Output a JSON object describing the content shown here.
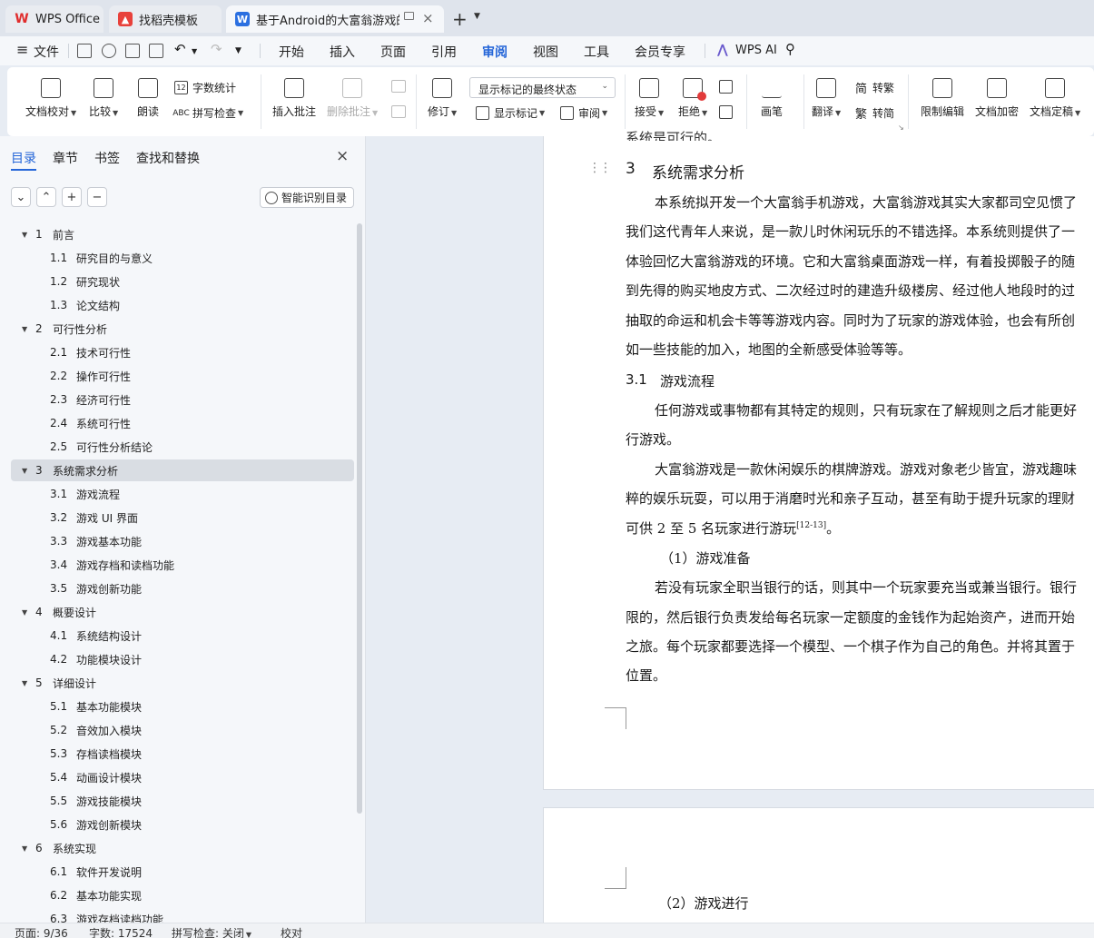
{
  "tabs": [
    {
      "label": "WPS Office",
      "icon": "wps-logo-icon",
      "color": "#e02d2d"
    },
    {
      "label": "找稻壳模板",
      "icon": "docer-logo-icon",
      "color": "#e8413b"
    },
    {
      "label": "基于Android的大富翁游戏的设",
      "icon": "word-doc-icon",
      "color": "#2b6fe0"
    }
  ],
  "menu": {
    "file": "文件",
    "items": [
      "开始",
      "插入",
      "页面",
      "引用",
      "审阅",
      "视图",
      "工具",
      "会员专享"
    ],
    "active": "审阅",
    "wps_ai": "WPS AI"
  },
  "ribbon": {
    "proofread": "文档校对",
    "compare": "比较",
    "read_aloud": "朗读",
    "word_count": "字数统计",
    "spell_check": "拼写检查",
    "insert_comment": "插入批注",
    "delete_comment": "删除批注",
    "track_changes": "修订",
    "markup_state": "显示标记的最终状态",
    "show_markup": "显示标记",
    "review_pane": "审阅",
    "accept": "接受",
    "reject": "拒绝",
    "pen": "画笔",
    "translate": "翻译",
    "to_traditional": "转繁",
    "to_simplified": "转简",
    "restrict_edit": "限制编辑",
    "encrypt": "文档加密",
    "finalize": "文档定稿",
    "spell_icon_text": "ABC",
    "count_icon_text": "12",
    "trad_icon": "简",
    "simp_icon": "繁"
  },
  "nav": {
    "tabs": [
      "目录",
      "章节",
      "书签",
      "查找和替换"
    ],
    "smart_toc": "智能识别目录",
    "toc": [
      {
        "num": "1",
        "title": "前言",
        "level": 1
      },
      {
        "num": "1.1",
        "title": "研究目的与意义",
        "level": 2
      },
      {
        "num": "1.2",
        "title": "研究现状",
        "level": 2
      },
      {
        "num": "1.3",
        "title": "论文结构",
        "level": 2
      },
      {
        "num": "2",
        "title": "可行性分析",
        "level": 1
      },
      {
        "num": "2.1",
        "title": "技术可行性",
        "level": 2
      },
      {
        "num": "2.2",
        "title": "操作可行性",
        "level": 2
      },
      {
        "num": "2.3",
        "title": "经济可行性",
        "level": 2
      },
      {
        "num": "2.4",
        "title": "系统可行性",
        "level": 2
      },
      {
        "num": "2.5",
        "title": "可行性分析结论",
        "level": 2
      },
      {
        "num": "3",
        "title": "系统需求分析",
        "level": 1,
        "selected": true
      },
      {
        "num": "3.1",
        "title": "游戏流程",
        "level": 2
      },
      {
        "num": "3.2",
        "title": "游戏 UI 界面",
        "level": 2
      },
      {
        "num": "3.3",
        "title": "游戏基本功能",
        "level": 2
      },
      {
        "num": "3.4",
        "title": "游戏存档和读档功能",
        "level": 2
      },
      {
        "num": "3.5",
        "title": "游戏创新功能",
        "level": 2
      },
      {
        "num": "4",
        "title": "概要设计",
        "level": 1
      },
      {
        "num": "4.1",
        "title": "系统结构设计",
        "level": 2
      },
      {
        "num": "4.2",
        "title": "功能模块设计",
        "level": 2
      },
      {
        "num": "5",
        "title": "详细设计",
        "level": 1
      },
      {
        "num": "5.1",
        "title": "基本功能模块",
        "level": 2
      },
      {
        "num": "5.2",
        "title": "音效加入模块",
        "level": 2
      },
      {
        "num": "5.3",
        "title": "存档读档模块",
        "level": 2
      },
      {
        "num": "5.4",
        "title": "动画设计模块",
        "level": 2
      },
      {
        "num": "5.5",
        "title": "游戏技能模块",
        "level": 2
      },
      {
        "num": "5.6",
        "title": "游戏创新模块",
        "level": 2
      },
      {
        "num": "6",
        "title": "系统实现",
        "level": 1
      },
      {
        "num": "6.1",
        "title": "软件开发说明",
        "level": 2
      },
      {
        "num": "6.2",
        "title": "基本功能实现",
        "level": 2
      },
      {
        "num": "6.3",
        "title": "游戏存档读档功能",
        "level": 2
      }
    ]
  },
  "document": {
    "top_fragment": "系统是可行的。",
    "heading_num": "3",
    "heading": "系统需求分析",
    "lines": [
      "本系统拟开发一个大富翁手机游戏，大富翁游戏其实大家都司空见惯了",
      "我们这代青年人来说，是一款儿时休闲玩乐的不错选择。本系统则提供了一",
      "体验回忆大富翁游戏的环境。它和大富翁桌面游戏一样，有着投掷骰子的随",
      "到先得的购买地皮方式、二次经过时的建造升级楼房、经过他人地段时的过",
      "抽取的命运和机会卡等等游戏内容。同时为了玩家的游戏体验，也会有所创",
      "如一些技能的加入，地图的全新感受体验等等。"
    ],
    "sub_num": "3.1",
    "sub_heading": "游戏流程",
    "p2": [
      "任何游戏或事物都有其特定的规则，只有玩家在了解规则之后才能更好",
      "行游戏。"
    ],
    "p3": [
      "大富翁游戏是一款休闲娱乐的棋牌游戏。游戏对象老少皆宜，游戏趣味",
      "粹的娱乐玩耍，可以用于消磨时光和亲子互动，甚至有助于提升玩家的理财",
      "可供 2 至 5 名玩家进行游玩"
    ],
    "cite": "[12-13]",
    "cite_tail": "。",
    "prep": "（1）游戏准备",
    "p4": [
      "若没有玩家全职当银行的话，则其中一个玩家要充当或兼当银行。银行",
      "限的，然后银行负责发给每名玩家一定额度的金钱作为起始资产，进而开始",
      "之旅。每个玩家都要选择一个模型、一个棋子作为自己的角色。并将其置于",
      "位置。"
    ],
    "next_page_item": "（2）游戏进行"
  },
  "status": {
    "page": "页面: 9/36",
    "words": "字数: 17524",
    "spell": "拼写检查: 关闭",
    "proof": "校对"
  }
}
